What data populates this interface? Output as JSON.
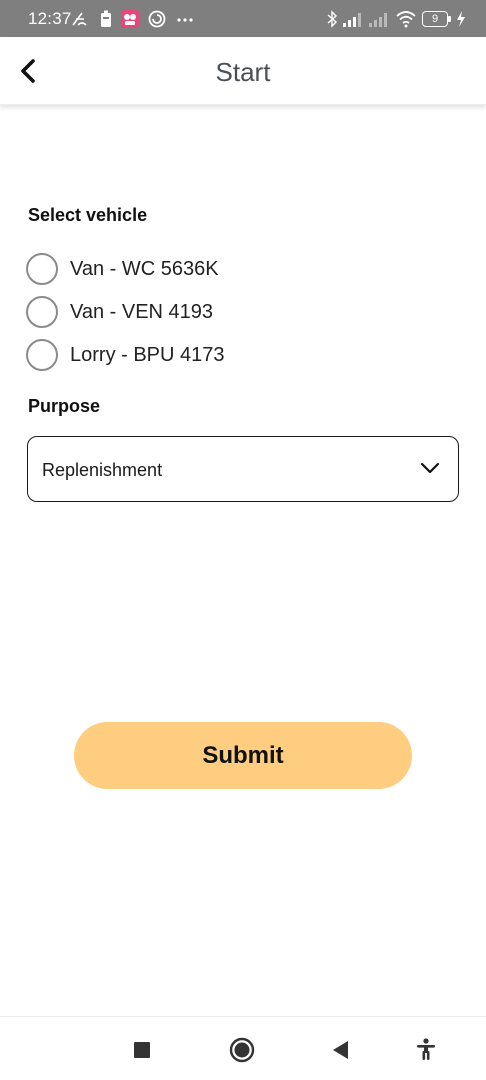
{
  "status_bar": {
    "time": "12:37",
    "battery_level": "9",
    "icons_left": [
      "gesture-icon",
      "battery-saver-icon",
      "app-notification-icon",
      "data-saver-icon",
      "more-notifications-icon"
    ],
    "icons_right": [
      "bluetooth-icon",
      "signal-icon",
      "signal-icon-2",
      "wifi-icon",
      "battery-icon",
      "charging-icon"
    ]
  },
  "header": {
    "title": "Start",
    "back_icon": "chevron-left-icon"
  },
  "form": {
    "vehicle_label": "Select vehicle",
    "vehicles": [
      {
        "label": "Van - WC 5636K",
        "selected": false
      },
      {
        "label": "Van - VEN 4193",
        "selected": false
      },
      {
        "label": "Lorry - BPU 4173",
        "selected": false
      }
    ],
    "purpose_label": "Purpose",
    "purpose_value": "Replenishment",
    "submit_label": "Submit"
  },
  "nav_bar": {
    "items": [
      "recents-icon",
      "home-icon",
      "back-icon",
      "accessibility-icon"
    ]
  },
  "colors": {
    "status_bar": "#7f7f7f",
    "submit_button": "#fecd80",
    "title_text": "#4a4f55",
    "radio_border": "#8a8a8a"
  }
}
